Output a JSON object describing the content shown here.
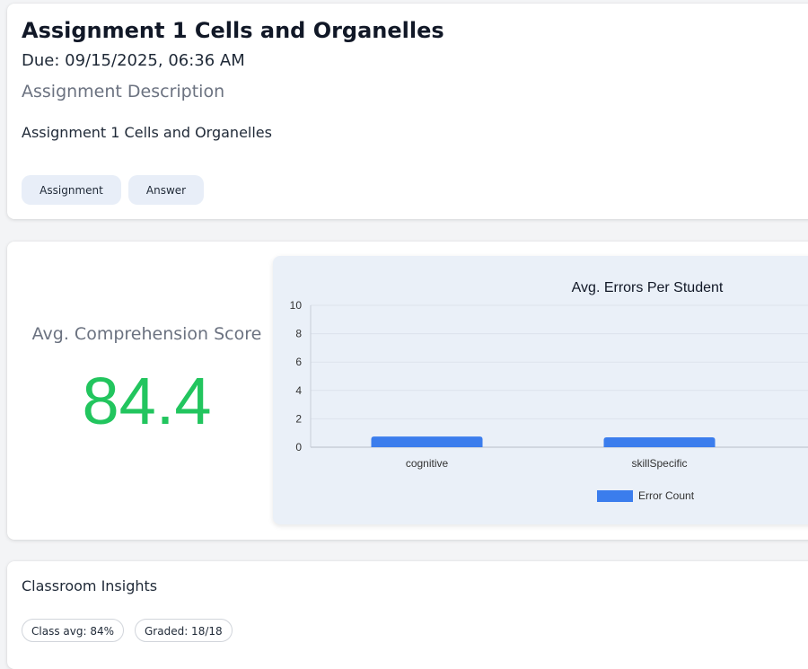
{
  "assignment": {
    "title": "Assignment 1 Cells and Organelles",
    "due": "Due: 09/15/2025, 06:36 AM",
    "description_heading": "Assignment Description",
    "description_text": "Assignment 1 Cells and Organelles",
    "buttons": {
      "assignment": "Assignment",
      "answer": "Answer"
    }
  },
  "stats": {
    "score_label": "Avg. Comprehension Score",
    "score_value": "84.4",
    "score_color": "#22c55e"
  },
  "chart_data": {
    "type": "bar",
    "title": "Avg. Errors Per Student",
    "categories": [
      "cognitive",
      "skillSpecific"
    ],
    "series": [
      {
        "name": "Error Count",
        "values": [
          0.75,
          0.7
        ],
        "color": "#3b7ded"
      }
    ],
    "ylim": [
      0,
      10
    ],
    "yticks": [
      0,
      2,
      4,
      6,
      8,
      10
    ],
    "grid": true,
    "legend": "bottom",
    "xlabel": "",
    "ylabel": ""
  },
  "insights": {
    "title": "Classroom Insights",
    "chips": {
      "class_avg": "Class avg: 84%",
      "graded": "Graded: 18/18"
    }
  }
}
